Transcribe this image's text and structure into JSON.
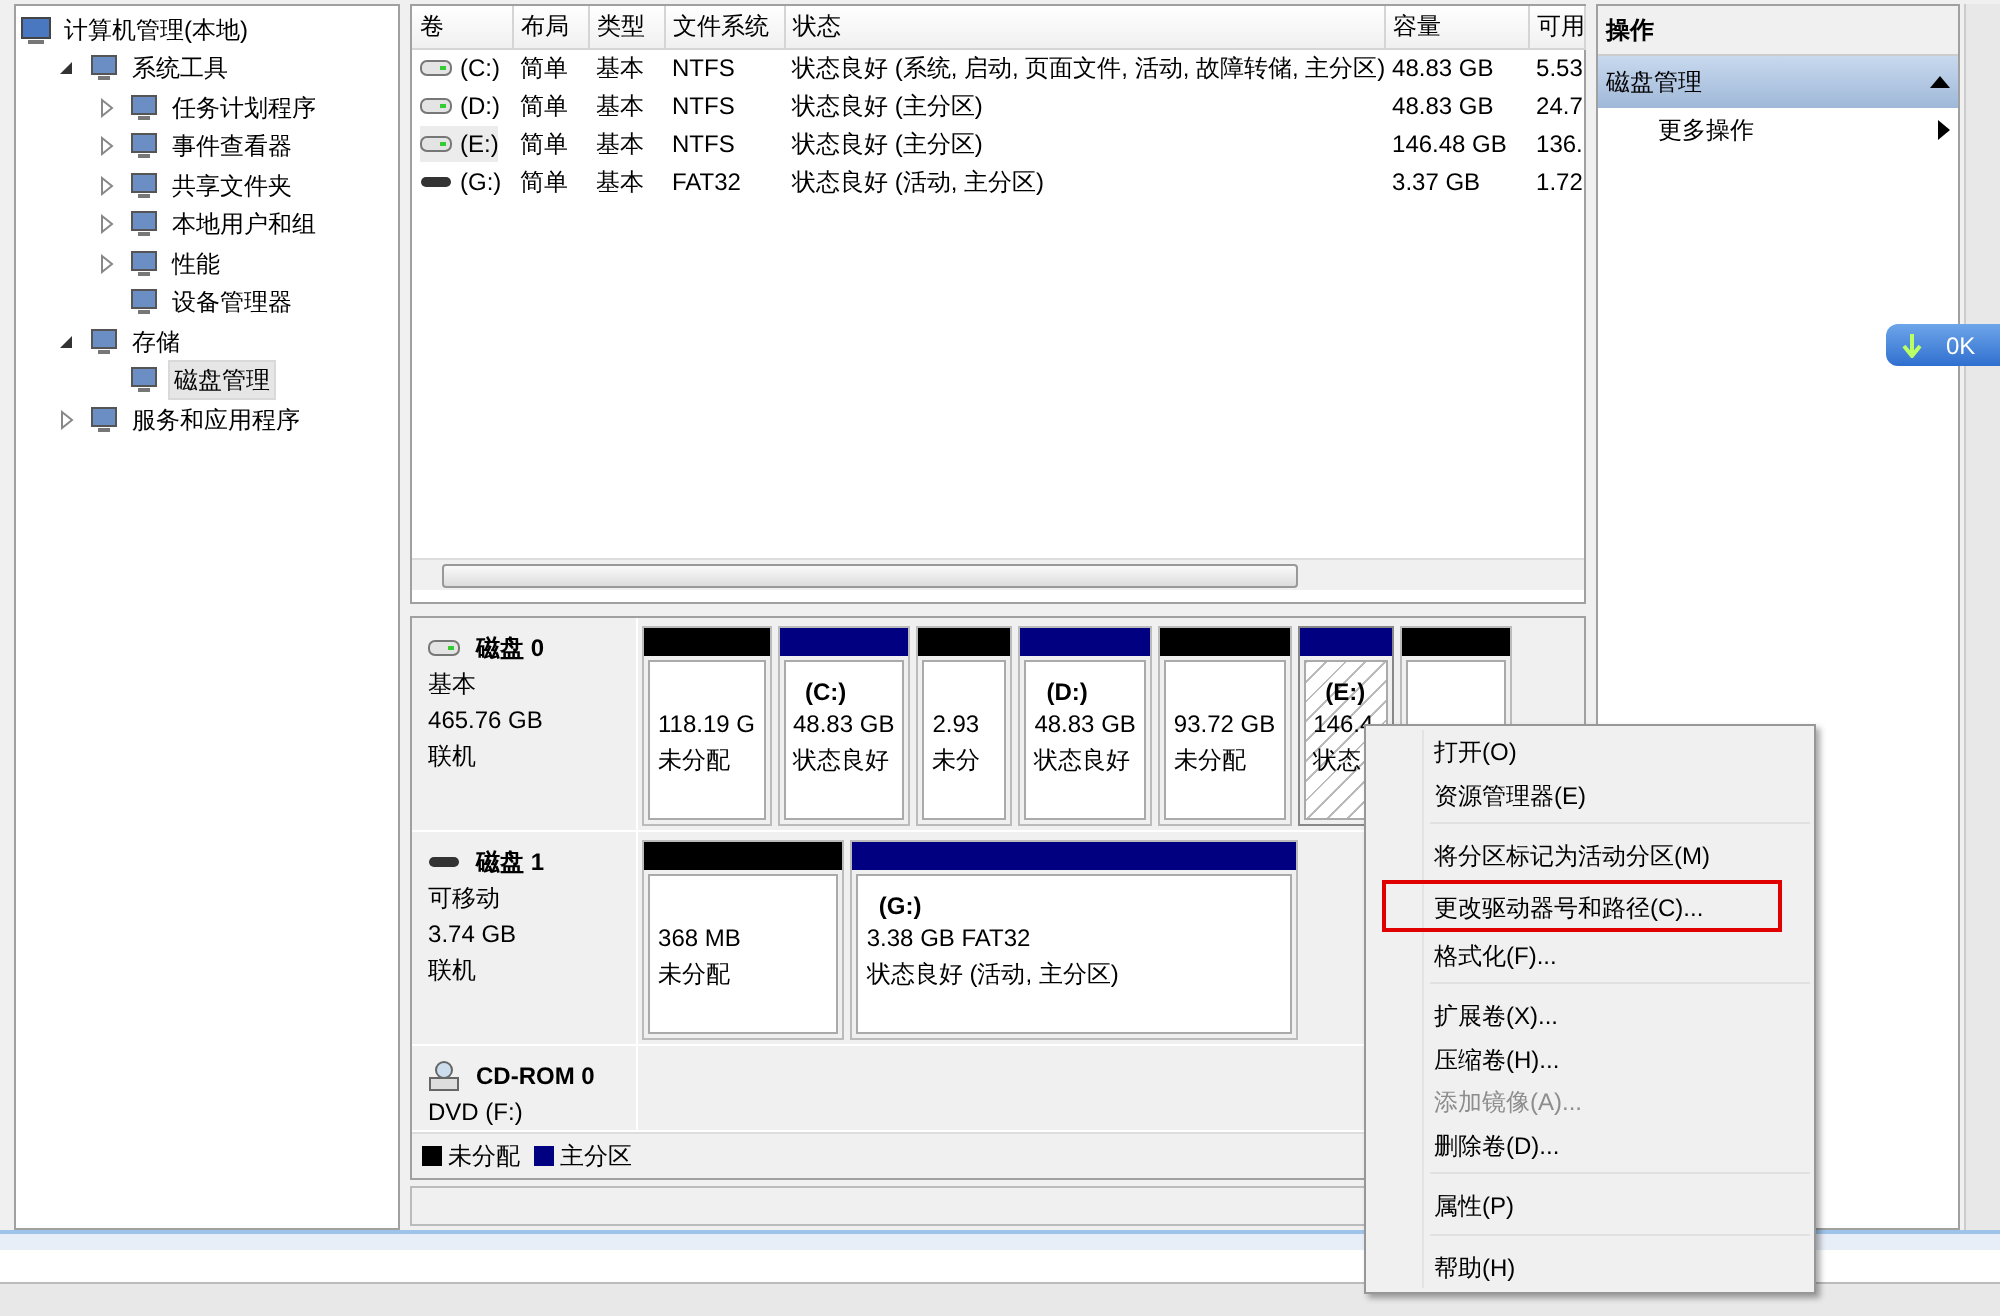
{
  "tree": {
    "root": {
      "label": "计算机管理(本地)",
      "selected": false,
      "children": [
        {
          "label": "系统工具",
          "selected": false,
          "expanded": true,
          "children": [
            {
              "label": "任务计划程序",
              "selected": false,
              "expanded": false
            },
            {
              "label": "事件查看器",
              "selected": false,
              "expanded": false
            },
            {
              "label": "共享文件夹",
              "selected": false,
              "expanded": false
            },
            {
              "label": "本地用户和组",
              "selected": false,
              "expanded": false
            },
            {
              "label": "性能",
              "selected": false,
              "expanded": false
            },
            {
              "label": "设备管理器",
              "selected": false
            }
          ]
        },
        {
          "label": "存储",
          "selected": false,
          "expanded": true,
          "children": [
            {
              "label": "磁盘管理",
              "selected": true
            }
          ]
        },
        {
          "label": "服务和应用程序",
          "selected": false,
          "expanded": false
        }
      ]
    }
  },
  "volumes": {
    "columns": [
      "卷",
      "布局",
      "类型",
      "文件系统",
      "状态",
      "容量",
      "可用"
    ],
    "rows": [
      {
        "kind": "fixed",
        "selected": false,
        "cells": [
          "(C:)",
          "简单",
          "基本",
          "NTFS",
          "状态良好 (系统, 启动, 页面文件, 活动, 故障转储, 主分区)",
          "48.83 GB",
          "5.53"
        ]
      },
      {
        "kind": "fixed",
        "selected": false,
        "cells": [
          "(D:)",
          "简单",
          "基本",
          "NTFS",
          "状态良好 (主分区)",
          "48.83 GB",
          "24.7"
        ]
      },
      {
        "kind": "fixed",
        "selected": true,
        "cells": [
          "(E:)",
          "简单",
          "基本",
          "NTFS",
          "状态良好 (主分区)",
          "146.48 GB",
          "136."
        ]
      },
      {
        "kind": "removable",
        "selected": false,
        "cells": [
          "(G:)",
          "简单",
          "基本",
          "FAT32",
          "状态良好 (活动, 主分区)",
          "3.37 GB",
          "1.72"
        ]
      }
    ]
  },
  "disks": [
    {
      "kind": "fixed",
      "name": "磁盘 0",
      "lines": [
        "基本",
        "465.76 GB",
        "联机"
      ],
      "partitions": [
        {
          "kind": "unallocated",
          "selected": false,
          "size": "118.19 G",
          "status": "未分配"
        },
        {
          "kind": "primary",
          "selected": false,
          "name": "(C:)",
          "size": "48.83 GB",
          "status": "状态良好"
        },
        {
          "kind": "unallocated",
          "selected": false,
          "size": "2.93",
          "status": "未分"
        },
        {
          "kind": "primary",
          "selected": false,
          "name": "(D:)",
          "size": "48.83 GB",
          "status": "状态良好"
        },
        {
          "kind": "unallocated",
          "selected": false,
          "size": "93.72 GB",
          "status": "未分配"
        },
        {
          "kind": "primary",
          "selected": true,
          "name": "(E:)",
          "size": "146.4",
          "status": "状态"
        },
        {
          "kind": "unallocated",
          "selected": false
        }
      ]
    },
    {
      "kind": "removable",
      "name": "磁盘 1",
      "lines": [
        "可移动",
        "3.74 GB",
        "联机"
      ],
      "partitions": [
        {
          "kind": "unallocated",
          "selected": false,
          "size": "368 MB",
          "status": "未分配"
        },
        {
          "kind": "primary",
          "selected": false,
          "name": "(G:)",
          "size": "3.38 GB FAT32",
          "status": "状态良好 (活动, 主分区)"
        }
      ]
    },
    {
      "kind": "cdrom",
      "name": "CD-ROM 0",
      "lines": [
        "DVD (F:)"
      ]
    }
  ],
  "legend": [
    {
      "label": "未分配",
      "color": "#000000"
    },
    {
      "label": "主分区",
      "color": "#000080"
    }
  ],
  "actions": {
    "title": "操作",
    "sections": [
      {
        "title": "磁盘管理",
        "expanded": true,
        "items": [
          {
            "label": "更多操作"
          }
        ]
      }
    ]
  },
  "context_menu": [
    {
      "kind": "item",
      "label": "打开(O)",
      "disabled": false,
      "highlighted": false
    },
    {
      "kind": "item",
      "label": "资源管理器(E)",
      "disabled": false,
      "highlighted": false
    },
    {
      "kind": "separator"
    },
    {
      "kind": "item",
      "label": "将分区标记为活动分区(M)",
      "disabled": false,
      "highlighted": false
    },
    {
      "kind": "item",
      "label": "更改驱动器号和路径(C)...",
      "disabled": false,
      "highlighted": true
    },
    {
      "kind": "item",
      "label": "格式化(F)...",
      "disabled": false,
      "highlighted": false
    },
    {
      "kind": "separator"
    },
    {
      "kind": "item",
      "label": "扩展卷(X)...",
      "disabled": false,
      "highlighted": false
    },
    {
      "kind": "item",
      "label": "压缩卷(H)...",
      "disabled": false,
      "highlighted": false
    },
    {
      "kind": "item",
      "label": "添加镜像(A)...",
      "disabled": true,
      "highlighted": false
    },
    {
      "kind": "item",
      "label": "删除卷(D)...",
      "disabled": false,
      "highlighted": false
    },
    {
      "kind": "separator"
    },
    {
      "kind": "item",
      "label": "属性(P)",
      "disabled": false,
      "highlighted": false
    },
    {
      "kind": "separator"
    },
    {
      "kind": "item",
      "label": "帮助(H)",
      "disabled": false,
      "highlighted": false
    }
  ],
  "download_widget": {
    "text": "0K"
  }
}
